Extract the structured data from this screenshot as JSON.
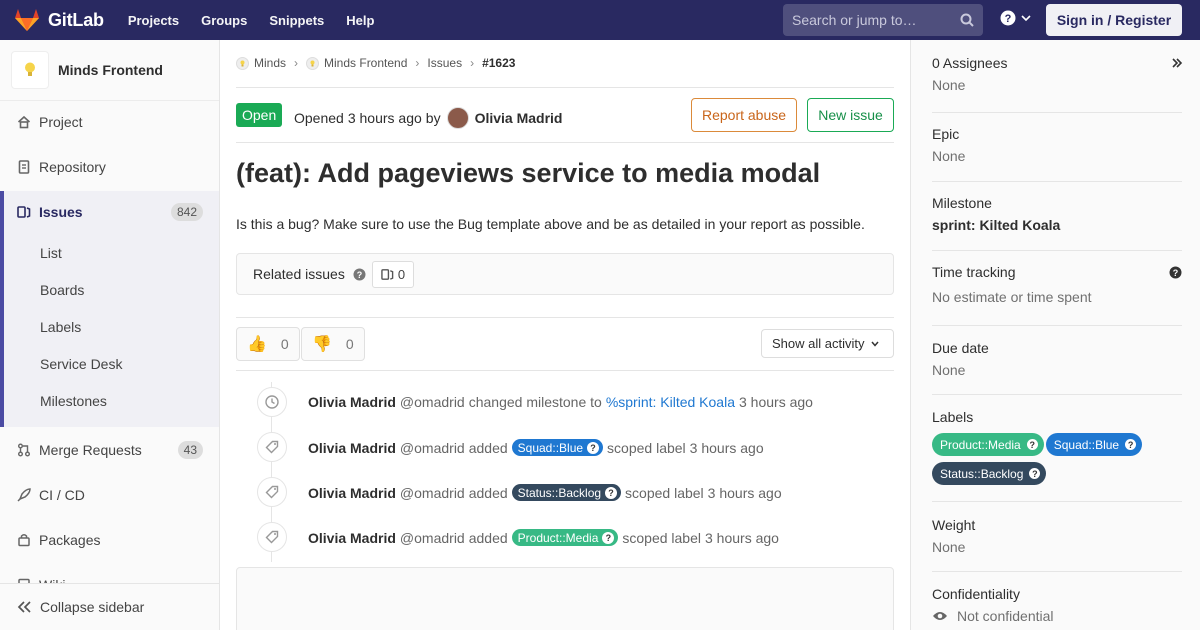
{
  "navbar": {
    "brand": "GitLab",
    "links": [
      "Projects",
      "Groups",
      "Snippets",
      "Help"
    ],
    "search_placeholder": "Search or jump to…",
    "sign_in_label": "Sign in / Register"
  },
  "sidebar": {
    "project_name": "Minds Frontend",
    "items": [
      {
        "label": "Project"
      },
      {
        "label": "Repository"
      },
      {
        "label": "Issues",
        "count": "842"
      },
      {
        "label": "Merge Requests",
        "count": "43"
      },
      {
        "label": "CI / CD"
      },
      {
        "label": "Packages"
      },
      {
        "label": "Wiki"
      }
    ],
    "issue_subitems": [
      "List",
      "Boards",
      "Labels",
      "Service Desk",
      "Milestones"
    ],
    "collapse_label": "Collapse sidebar"
  },
  "breadcrumb": [
    "Minds",
    "Minds Frontend",
    "Issues",
    "#1623"
  ],
  "issue": {
    "status": "Open",
    "opened_prefix": "Opened",
    "opened_time": "3 hours ago",
    "opened_by": "by",
    "author": "Olivia Madrid",
    "report_label": "Report abuse",
    "new_issue_label": "New issue",
    "title": "(feat): Add pageviews service to media modal",
    "description": "Is this a bug? Make sure to use the Bug template above and be as detailed in your report as possible.",
    "related_label": "Related issues",
    "related_count": "0",
    "thumbs_up": "0",
    "thumbs_down": "0",
    "activity_filter": "Show all activity"
  },
  "timeline": [
    {
      "who": "Olivia Madrid",
      "handle": "@omadrid",
      "action": "changed milestone to",
      "link": "%sprint: Kilted Koala",
      "time": "3 hours ago"
    },
    {
      "who": "Olivia Madrid",
      "handle": "@omadrid",
      "action": "added",
      "label": "Squad::Blue",
      "label_color": "#1f78d1",
      "suffix": "scoped label",
      "time": "3 hours ago"
    },
    {
      "who": "Olivia Madrid",
      "handle": "@omadrid",
      "action": "added",
      "label": "Status::Backlog",
      "label_color": "#34495e",
      "suffix": "scoped label",
      "time": "3 hours ago"
    },
    {
      "who": "Olivia Madrid",
      "handle": "@omadrid",
      "action": "added",
      "label": "Product::Media",
      "label_color": "#37b985",
      "suffix": "scoped label",
      "time": "3 hours ago"
    }
  ],
  "right_sidebar": {
    "assignees_title": "0 Assignees",
    "assignees_value": "None",
    "epic_title": "Epic",
    "epic_value": "None",
    "milestone_title": "Milestone",
    "milestone_value": "sprint: Kilted Koala",
    "time_title": "Time tracking",
    "time_value": "No estimate or time spent",
    "due_title": "Due date",
    "due_value": "None",
    "labels_title": "Labels",
    "labels": [
      {
        "name": "Product::Media",
        "color": "#37b985"
      },
      {
        "name": "Squad::Blue",
        "color": "#1f78d1"
      },
      {
        "name": "Status::Backlog",
        "color": "#34495e"
      }
    ],
    "weight_title": "Weight",
    "weight_value": "None",
    "confidentiality_title": "Confidentiality",
    "confidentiality_value": "Not confidential"
  }
}
